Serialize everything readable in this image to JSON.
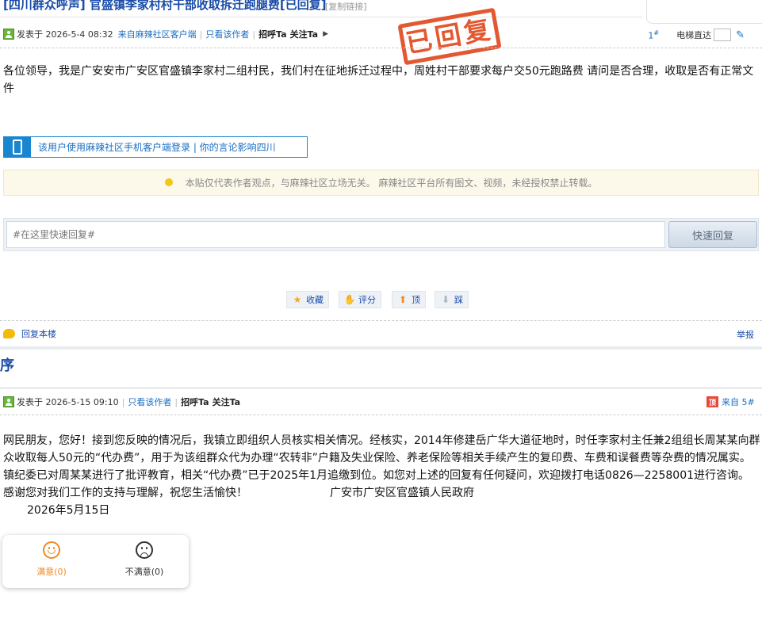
{
  "thread": {
    "title": "[四川群众呼声] 官盛镇李家村村干部收取拆迁跑腿费[已回复]",
    "copy_link": "[复制链接]"
  },
  "post1": {
    "posted_label": "发表于 2026-5-4 08:32",
    "client_link": "来自麻辣社区客户端",
    "only_author": "只看该作者",
    "greet": "招呼Ta",
    "follow": "关注Ta",
    "floor": "1",
    "floor_mark": "#",
    "jump_label": "电梯直达",
    "stamp_text": "已回复",
    "content": "各位领导，我是广安安市广安区官盛镇李家村二组村民，我们村在征地拆迁过程中，周姓村干部要求每户交50元跑路费 请问是否合理，收取是否有正常文件"
  },
  "client_banner": "该用户使用麻辣社区手机客户端登录 | 你的言论影响四川",
  "notice": "本贴仅代表作者观点，与麻辣社区立场无关。  麻辣社区平台所有图文、视频，未经授权禁止转载。",
  "quick_reply": {
    "placeholder": "#在这里快速回复#",
    "button": "快速回复"
  },
  "actions": {
    "favorite": "收藏",
    "rate": "评分",
    "up": "顶",
    "down": "踩"
  },
  "reply_floor": "回复本楼",
  "report": "举报",
  "section_title": "序",
  "post2": {
    "posted_label": "发表于 2026-5-15 09:10",
    "only_author": "只看该作者",
    "greet": "招呼Ta",
    "follow": "关注Ta",
    "top_badge": "顶",
    "floor": "来自 5#",
    "paragraph": "网民朋友，您好！接到您反映的情况后，我镇立即组织人员核实相关情况。经核实，2014年修建岳广华大道征地时，时任李家村主任兼2组组长周某某向群众收取每人50元的“代办费”，用于为该组群众代为办理“农转非”户籍及失业保险、养老保险等相关手续产生的复印费、车费和误餐费等杂费的情况属实。镇纪委已对周某某进行了批评教育，相关“代办费”已于2025年1月追缴到位。如您对上述的回复有任何疑问，欢迎拨打电话0826—2258001进行咨询。 感谢您对我们工作的支持与理解，祝您生活愉快！",
    "signature": "广安市广安区官盛镇人民政府",
    "date": "2026年5月15日"
  },
  "rating": {
    "satisfied": "满意(0)",
    "unsatisfied": "不满意(0)"
  },
  "colors": {
    "link_blue": "#1a4ca8",
    "stamp_red": "#e14a1f",
    "satisfied_orange": "#f08a24"
  }
}
